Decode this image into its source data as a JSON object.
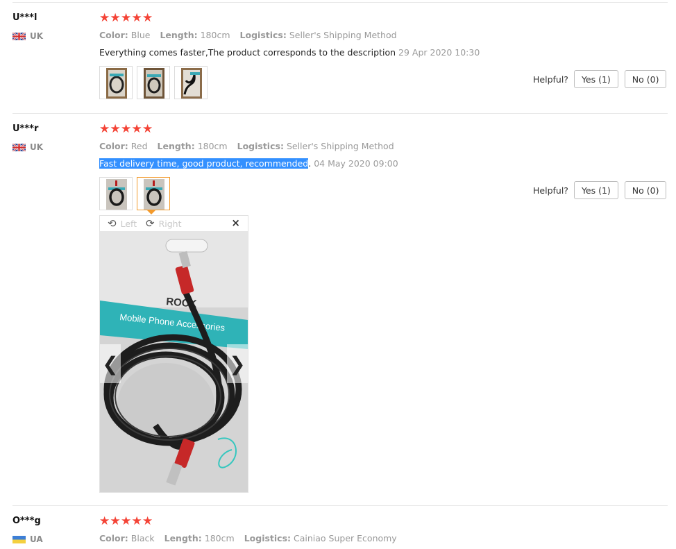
{
  "reviews": [
    {
      "user": "U***l",
      "country": "UK",
      "stars": 5,
      "color_label": "Color:",
      "color_value": "Blue",
      "length_label": "Length:",
      "length_value": "180cm",
      "logistics_label": "Logistics:",
      "logistics_value": "Seller's Shipping Method",
      "text": "Everything comes faster,The product corresponds to the description",
      "date": "29 Apr 2020 10:30",
      "helpful_label": "Helpful?",
      "yes_label": "Yes (1)",
      "no_label": "No (0)",
      "thumb_count": 3
    },
    {
      "user": "U***r",
      "country": "UK",
      "stars": 5,
      "color_label": "Color:",
      "color_value": "Red",
      "length_label": "Length:",
      "length_value": "180cm",
      "logistics_label": "Logistics:",
      "logistics_value": "Seller's Shipping Method",
      "text_selected": "Fast delivery time, good product, recommended",
      "text_rest": ".",
      "date": "04 May 2020 09:00",
      "helpful_label": "Helpful?",
      "yes_label": "Yes (1)",
      "no_label": "No (0)",
      "thumb_count": 2
    },
    {
      "user": "O***g",
      "country": "UA",
      "stars": 5,
      "color_label": "Color:",
      "color_value": "Black",
      "length_label": "Length:",
      "length_value": "180cm",
      "logistics_label": "Logistics:",
      "logistics_value": "Cainiao Super Economy"
    }
  ],
  "viewer": {
    "rotate_left_label": "Left",
    "rotate_right_label": "Right",
    "close_symbol": "×",
    "prev_symbol": "❮",
    "next_symbol": "❯",
    "packaging_brand": "ROCK",
    "packaging_caption": "Mobile Phone Accessories"
  },
  "icons": {
    "star": "star-icon",
    "flag_uk": "uk-flag-icon",
    "flag_ua": "ua-flag-icon",
    "rotate_left": "rotate-left-icon",
    "rotate_right": "rotate-right-icon",
    "close": "close-icon"
  },
  "colors": {
    "star": "#f44336",
    "selection": "#3390ff",
    "active_thumb": "#f39a2b",
    "muted_text": "#999999"
  }
}
